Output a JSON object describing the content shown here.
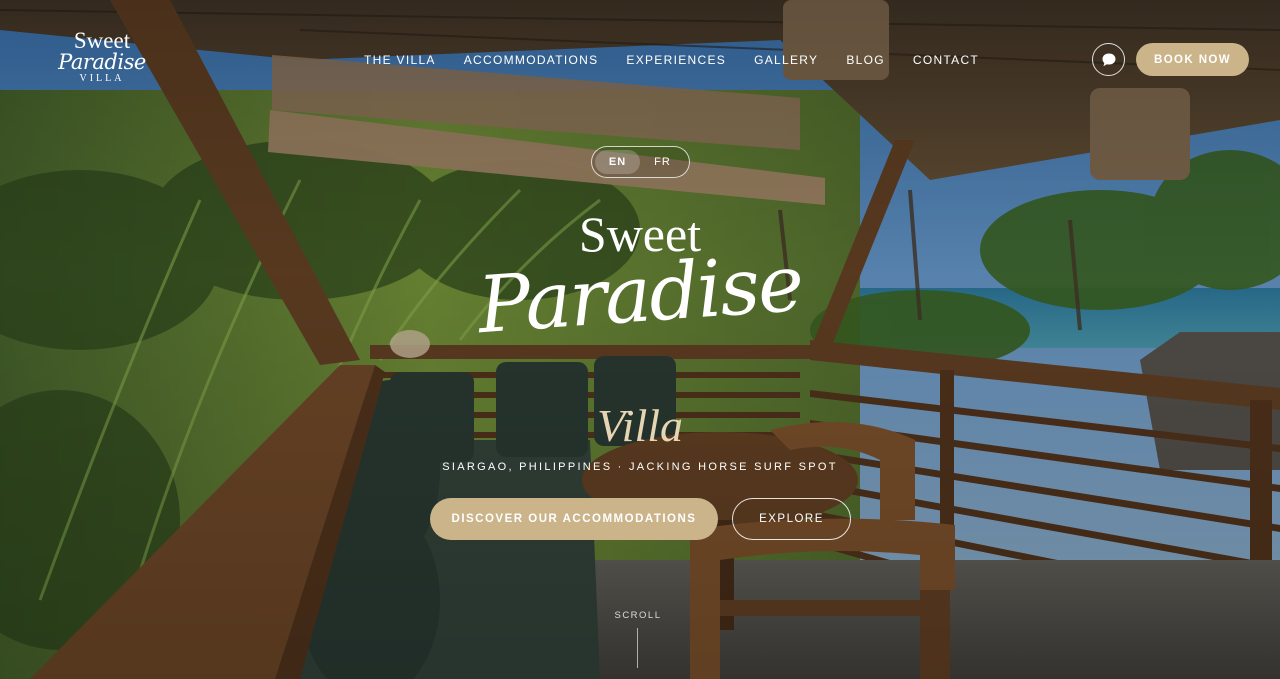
{
  "brand": {
    "logo_line1": "Sweet",
    "logo_line2": "Paradise",
    "logo_line3": "VILLA"
  },
  "nav": {
    "items": [
      "THE VILLA",
      "ACCOMMODATIONS",
      "EXPERIENCES",
      "GALLERY",
      "BLOG",
      "CONTACT"
    ]
  },
  "header": {
    "chat_icon": "chat-bubble-icon",
    "book_label": "BOOK NOW"
  },
  "language": {
    "options": [
      "EN",
      "FR"
    ],
    "selected": "EN"
  },
  "hero": {
    "title_line1": "Sweet",
    "title_line2": "Paradise",
    "title_line3": "Villa",
    "location": "SIARGAO, PHILIPPINES · JACKING HORSE SURF SPOT",
    "primary_cta": "DISCOVER OUR ACCOMMODATIONS",
    "secondary_cta": "EXPLORE",
    "scroll_label": "SCROLL"
  },
  "colors": {
    "accent_gold": "#cbb38a",
    "villa_cream": "#e6d5b4"
  }
}
